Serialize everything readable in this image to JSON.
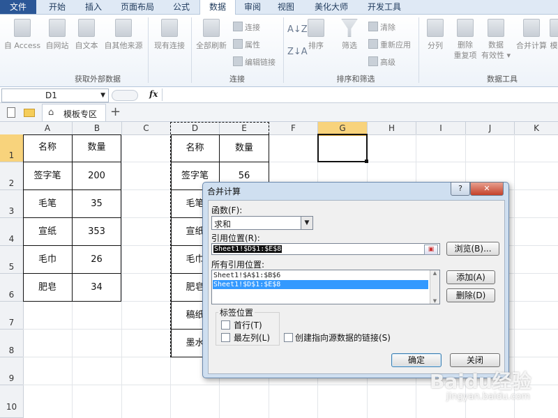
{
  "ribbon": {
    "tabs": [
      "文件",
      "开始",
      "插入",
      "页面布局",
      "公式",
      "数据",
      "审阅",
      "视图",
      "美化大师",
      "开发工具"
    ],
    "active_tab": "数据",
    "groups": {
      "external": {
        "label": "获取外部数据",
        "buttons": [
          "自 Access",
          "自网站",
          "自文本",
          "自其他来源",
          "现有连接"
        ]
      },
      "connections": {
        "label": "连接",
        "big": "全部刷新",
        "small": [
          "连接",
          "属性",
          "编辑链接"
        ]
      },
      "sort": {
        "label": "排序和筛选",
        "sort_btn": "排序",
        "filter_btn": "筛选",
        "small": [
          "清除",
          "重新应用",
          "高级"
        ]
      },
      "tools": {
        "label": "数据工具",
        "buttons": [
          {
            "l1": "分列",
            "l2": ""
          },
          {
            "l1": "删除",
            "l2": "重复项"
          },
          {
            "l1": "数据",
            "l2": "有效性 ▾"
          },
          {
            "l1": "合并计算",
            "l2": ""
          },
          {
            "l1": "模",
            "l2": ""
          }
        ]
      }
    }
  },
  "formula_bar": {
    "name_box": "D1",
    "fx": "fx"
  },
  "workbook_tab": "模板专区",
  "columns": [
    "A",
    "B",
    "C",
    "D",
    "E",
    "F",
    "G",
    "H",
    "I",
    "J",
    "K"
  ],
  "rows": [
    "1",
    "2",
    "3",
    "4",
    "5",
    "6",
    "7",
    "8",
    "9",
    "10"
  ],
  "left_table": {
    "headers": [
      "名称",
      "数量"
    ],
    "rows": [
      [
        "签字笔",
        "200"
      ],
      [
        "毛笔",
        "35"
      ],
      [
        "宣纸",
        "353"
      ],
      [
        "毛巾",
        "26"
      ],
      [
        "肥皂",
        "34"
      ]
    ]
  },
  "right_table": {
    "headers": [
      "名称",
      "数量"
    ],
    "col_d_visible": [
      "签字笔",
      "毛笔",
      "宣纸",
      "毛巾",
      "肥皂",
      "稿纸",
      "墨水"
    ],
    "col_e_visible": [
      "56"
    ]
  },
  "dialog": {
    "title": "合并计算",
    "help": "?",
    "function_label": "函数(F):",
    "function_value": "求和",
    "ref_label": "引用位置(R):",
    "ref_value": "Sheet1!$D$1:$E$8",
    "browse": "浏览(B)...",
    "all_refs_label": "所有引用位置:",
    "all_refs": [
      "Sheet1!$A$1:$B$6",
      "Sheet1!$D$1:$E$8"
    ],
    "add": "添加(A)",
    "delete": "删除(D)",
    "label_pos": "标签位置",
    "first_row": "首行(T)",
    "left_col": "最左列(L)",
    "create_links": "创建指向源数据的链接(S)",
    "ok": "确定",
    "close": "关闭"
  },
  "watermark": {
    "brand": "Baidu经验",
    "url": "jingyan.baidu.com"
  }
}
